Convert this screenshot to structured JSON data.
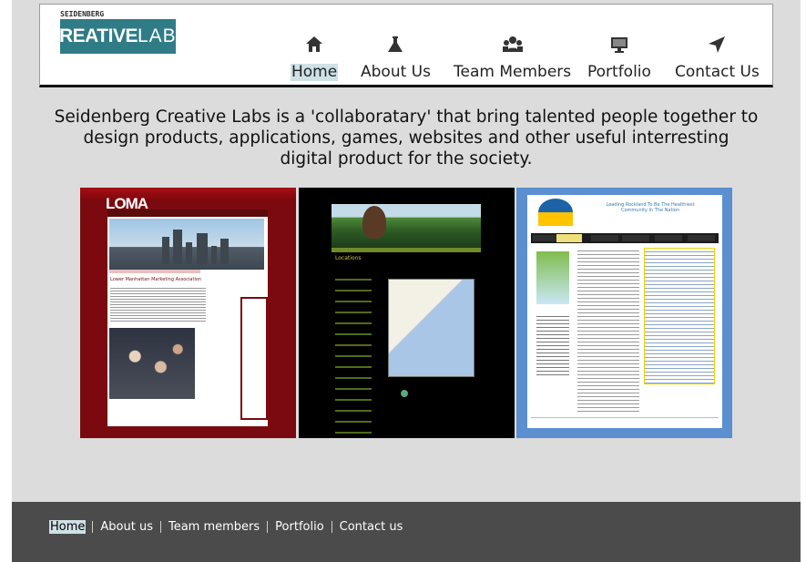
{
  "logo": {
    "small_text": "SEIDENBERG",
    "part1": "CREATIVE",
    "part2": "LABS"
  },
  "nav": [
    {
      "label": "Home",
      "icon": "home-icon",
      "active": true
    },
    {
      "label": "About Us",
      "icon": "flask-icon",
      "active": false
    },
    {
      "label": "Team Members",
      "icon": "users-icon",
      "active": false
    },
    {
      "label": "Portfolio",
      "icon": "monitor-icon",
      "active": false
    },
    {
      "label": "Contact Us",
      "icon": "location-arrow-icon",
      "active": false
    }
  ],
  "intro": {
    "line1": "Seidenberg Creative Labs is a 'collaboratary' that bring talented people together to",
    "line2": "design products, applications, games, websites and other useful interresting",
    "line3": "digital product for the society."
  },
  "portfolio": {
    "shot1": {
      "brand": "LOMA",
      "heading": "Lower Manhattan Marketing Association"
    },
    "shot2": {
      "section": "Locations"
    },
    "shot3": {
      "tagline": "Leading Rockland To Be The Healthiest Community In The Nation"
    }
  },
  "footer": {
    "links": [
      "Home",
      "About us",
      "Team members",
      "Portfolio",
      "Contact us"
    ]
  },
  "colors": {
    "logo_teal": "#2f7c86",
    "active_highlight": "#cfe1e6",
    "footer_bg": "#4b4b4b",
    "page_bg": "#dcdcdc"
  }
}
